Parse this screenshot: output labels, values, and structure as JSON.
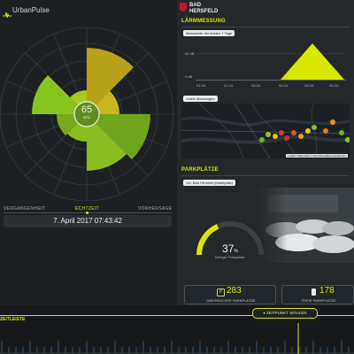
{
  "brand": {
    "app_name": "UrbanPulse",
    "city_line1": "BAD",
    "city_line2": "HERSFELD"
  },
  "colors": {
    "accent": "#d8e600",
    "green": "#7dbb1f",
    "olive": "#b8a21a",
    "yellow_green": "#b9cf1e",
    "bg": "#1c1f22"
  },
  "pulse": {
    "value": "65",
    "unit": "BPM"
  },
  "timeline": {
    "past_label": "VERGANGENHEIT",
    "now_label": "ECHTZEIT",
    "future_label": "VORHERSAGE",
    "datetime": "7. April 2017 07:43:42",
    "bar_label": "ZEITLEISTE",
    "select_button": "ZEITPUNKT WÄHLEN"
  },
  "noise": {
    "title": "LÄRMMESSUNG",
    "chip_week": "Messwerte der letzten 7 Tage",
    "y_labels": [
      "50 dB",
      "0 dB"
    ],
    "x_labels": [
      "01.04.",
      "02.04.",
      "03.04.",
      "04.04.",
      "05.04.",
      "06.04."
    ],
    "chip_latest": "Letzte Messungen",
    "map_credit": "Leaflet | Map data © OpenStreetMap contributors"
  },
  "parking": {
    "title": "PARKPLÄTZE",
    "location_chip": "Ort: Bad Hersfeld (Marktplatz)",
    "occupancy": "37",
    "occupancy_unit": "%",
    "occupancy_label": "Belegte Parkplätze",
    "occupancy_fraction": 0.37,
    "monitored_count": "283",
    "monitored_label": "ÜBERWACHTE PARKPLÄTZE",
    "free_count": "178",
    "free_label": "FREIE PARKPLÄTZE"
  }
}
